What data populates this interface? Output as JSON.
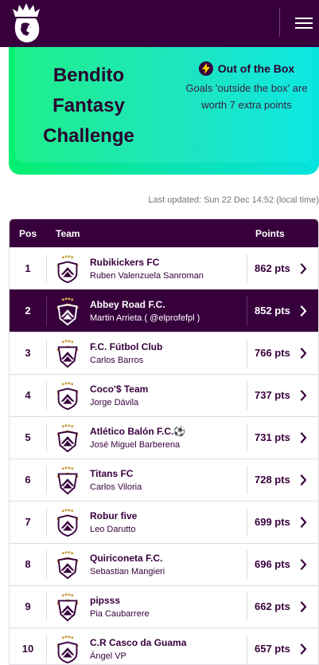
{
  "header": {
    "logo_icon": "premier-league-lion-icon",
    "menu_icon": "hamburger-menu-icon"
  },
  "banner": {
    "title": [
      "Bendito",
      "Fantasy",
      "Challenge"
    ],
    "powerup_icon": "lightning-bolt-icon",
    "powerup_title": "Out of the Box",
    "powerup_desc": "Goals 'outside the box' are worth 7 extra points"
  },
  "last_updated": "Last updated: Sun 22 Dec 14:52 (local time)",
  "table": {
    "headers": {
      "pos": "Pos",
      "team": "Team",
      "points": "Points"
    },
    "rows": [
      {
        "pos": "1",
        "team": "Rubikickers FC",
        "manager": "Ruben Valenzuela Sanroman",
        "points": "862 pts",
        "active": false
      },
      {
        "pos": "2",
        "team": "Abbey Road F.C.",
        "manager": "Martin Arrieta ( @elprofefpl )",
        "points": "852 pts",
        "active": true
      },
      {
        "pos": "3",
        "team": "F.C. Fútbol Club",
        "manager": "Carlos Barros",
        "points": "766 pts",
        "active": false
      },
      {
        "pos": "4",
        "team": "Coco'$ Team",
        "manager": "Jorge Dávila",
        "points": "737 pts",
        "active": false
      },
      {
        "pos": "5",
        "team": "Atlético Balón F.C.⚽",
        "manager": "José Miguel Barberena",
        "points": "731 pts",
        "active": false
      },
      {
        "pos": "6",
        "team": "Titans FC",
        "manager": "Carlos Viloria",
        "points": "728 pts",
        "active": false
      },
      {
        "pos": "7",
        "team": "Robur five",
        "manager": "Leo Darutto",
        "points": "699 pts",
        "active": false
      },
      {
        "pos": "8",
        "team": "Quiriconeta F.C.",
        "manager": "Sebastian Mangieri",
        "points": "696 pts",
        "active": false
      },
      {
        "pos": "9",
        "team": "pipsss",
        "manager": "Pia Caubarrere",
        "points": "662 pts",
        "active": false
      },
      {
        "pos": "10",
        "team": "C.R Casco da Guama",
        "manager": "Ángel VP",
        "points": "657 pts",
        "active": false
      }
    ]
  },
  "colors": {
    "brand_purple": "#37003c",
    "banner_green": "#04f06f",
    "banner_cyan": "#06e2de",
    "crest_gold": "#c9a24a"
  }
}
